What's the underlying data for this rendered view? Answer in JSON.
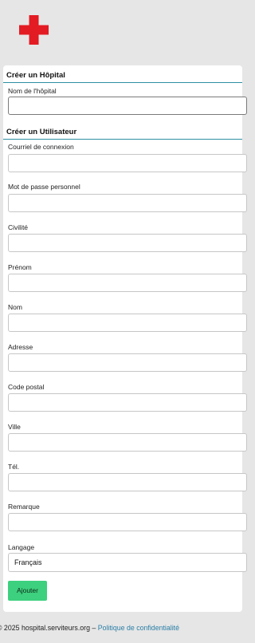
{
  "brand": {
    "logo_icon": "red-cross-icon",
    "logo_color": "#e31b23"
  },
  "hospital_section": {
    "title": "Créer un Hôpital",
    "fields": [
      {
        "label": "Nom de l'hôpital",
        "value": ""
      }
    ]
  },
  "user_section": {
    "title": "Créer un Utilisateur",
    "fields": [
      {
        "label": "Courriel de connexion",
        "value": ""
      },
      {
        "label": "Mot de passe personnel",
        "value": ""
      },
      {
        "label": "Civilité",
        "value": ""
      },
      {
        "label": "Prénom",
        "value": ""
      },
      {
        "label": "Nom",
        "value": ""
      },
      {
        "label": "Adresse",
        "value": ""
      },
      {
        "label": "Code postal",
        "value": ""
      },
      {
        "label": "Ville",
        "value": ""
      },
      {
        "label": "Tél.",
        "value": ""
      },
      {
        "label": "Remarque",
        "value": ""
      }
    ],
    "language": {
      "label": "Langage",
      "selected": "Français"
    }
  },
  "actions": {
    "submit_label": "Ajouter"
  },
  "colors": {
    "accent_rule": "#2e8fa3",
    "button": "#3dd07e",
    "link": "#2a7fa6"
  },
  "footer": {
    "copyright": "© 2025 hospital.serviteurs.org –",
    "privacy_link": "Politique de confidentialité"
  }
}
